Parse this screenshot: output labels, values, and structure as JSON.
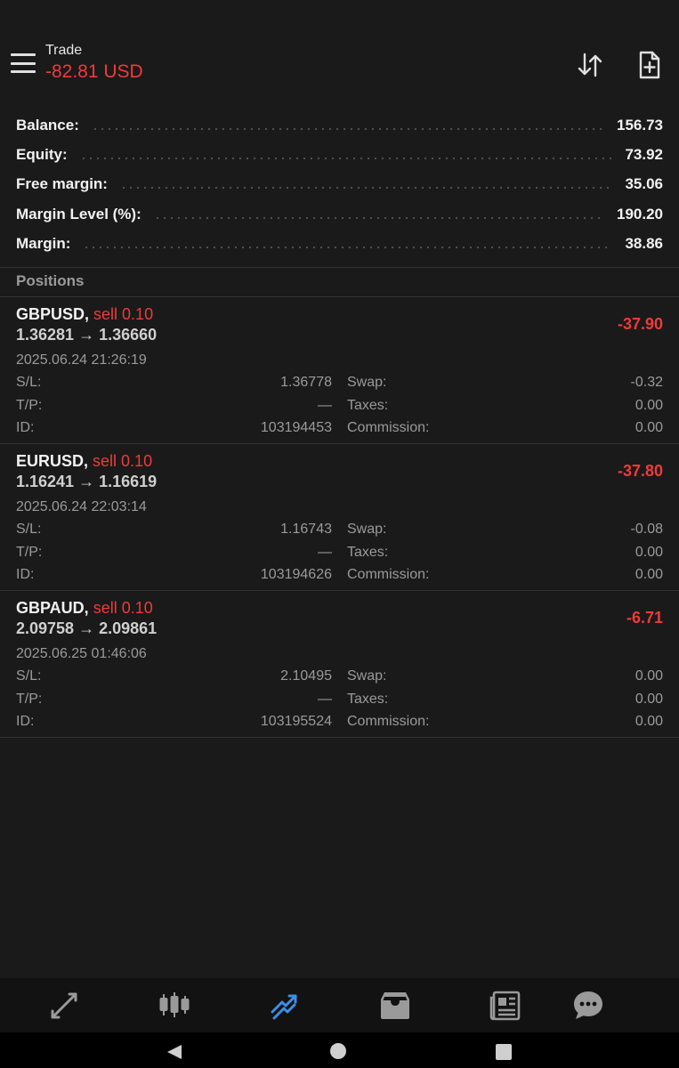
{
  "header": {
    "title": "Trade",
    "profit": "-82.81 USD"
  },
  "summary": [
    {
      "label": "Balance:",
      "value": "156.73"
    },
    {
      "label": "Equity:",
      "value": "73.92"
    },
    {
      "label": "Free margin:",
      "value": "35.06"
    },
    {
      "label": "Margin Level (%):",
      "value": "190.20"
    },
    {
      "label": "Margin:",
      "value": "38.86"
    }
  ],
  "positions_title": "Positions",
  "positions": [
    {
      "symbol": "GBPUSD,",
      "direction": "sell 0.10",
      "prices": "1.36281 → 1.36660",
      "profit": "-37.90",
      "time": "2025.06.24 21:26:19",
      "sl_label": "S/L:",
      "sl": "1.36778",
      "tp_label": "T/P:",
      "tp": "—",
      "id_label": "ID:",
      "id": "103194453",
      "swap_label": "Swap:",
      "swap": "-0.32",
      "taxes_label": "Taxes:",
      "taxes": "0.00",
      "commission_label": "Commission:",
      "commission": "0.00"
    },
    {
      "symbol": "EURUSD,",
      "direction": "sell 0.10",
      "prices": "1.16241 → 1.16619",
      "profit": "-37.80",
      "time": "2025.06.24 22:03:14",
      "sl_label": "S/L:",
      "sl": "1.16743",
      "tp_label": "T/P:",
      "tp": "—",
      "id_label": "ID:",
      "id": "103194626",
      "swap_label": "Swap:",
      "swap": "-0.08",
      "taxes_label": "Taxes:",
      "taxes": "0.00",
      "commission_label": "Commission:",
      "commission": "0.00"
    },
    {
      "symbol": "GBPAUD,",
      "direction": "sell 0.10",
      "prices": "2.09758 → 2.09861",
      "profit": "-6.71",
      "time": "2025.06.25 01:46:06",
      "sl_label": "S/L:",
      "sl": "2.10495",
      "tp_label": "T/P:",
      "tp": "—",
      "id_label": "ID:",
      "id": "103195524",
      "swap_label": "Swap:",
      "swap": "0.00",
      "taxes_label": "Taxes:",
      "taxes": "0.00",
      "commission_label": "Commission:",
      "commission": "0.00"
    }
  ],
  "colors": {
    "background": "#1a1a1a",
    "loss": "#f03a3a",
    "active_tab": "#3b8fe8",
    "inactive_icon": "#9a9a9a"
  },
  "bottom_nav": {
    "active": "trade",
    "items": [
      "quotes-icon",
      "chart-icon",
      "trade-icon",
      "history-icon",
      "news-icon",
      "chat-icon"
    ]
  }
}
